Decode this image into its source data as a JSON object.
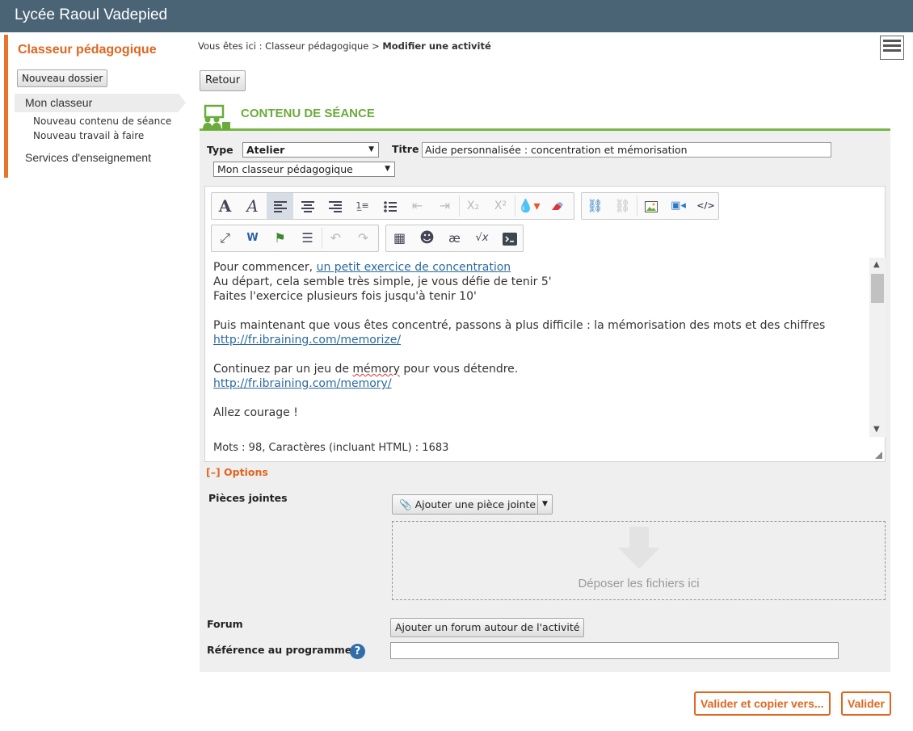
{
  "app": {
    "title": "Lycée Raoul Vadepied"
  },
  "sidebar": {
    "title": "Classeur pédagogique",
    "new_folder": "Nouveau dossier",
    "mon_classeur": "Mon classeur",
    "sub_items": [
      "Nouveau contenu de séance",
      "Nouveau travail à faire"
    ],
    "services": "Services d'enseignement"
  },
  "breadcrumb": {
    "prefix": "Vous êtes ici :",
    "parent": "Classeur pédagogique",
    "separator": ">",
    "current": "Modifier une activité"
  },
  "back_button": "Retour",
  "section": {
    "title": "CONTENU DE SÉANCE"
  },
  "form": {
    "type_label": "Type",
    "type_value": "Atelier",
    "title_label": "Titre",
    "title_value": "Aide personnalisée : concentration et mémorisation",
    "classeur_value": "Mon classeur pédagogique"
  },
  "editor": {
    "toolbar_row1": [
      "bold-font-icon",
      "italic-font-icon",
      "align-left-icon",
      "align-center-icon",
      "align-right-icon",
      "ordered-list-icon",
      "unordered-list-icon",
      "outdent-icon",
      "indent-icon",
      "subscript-icon",
      "superscript-icon",
      "text-color-icon",
      "highlight-icon",
      "link-icon",
      "unlink-icon",
      "image-icon",
      "media-icon",
      "source-code-icon"
    ],
    "toolbar_row2": [
      "fullscreen-icon",
      "paste-word-icon",
      "flag-icon",
      "list-table-icon",
      "undo-icon",
      "redo-icon",
      "table-icon",
      "emoji-icon",
      "special-chars-icon",
      "formula-icon",
      "terminal-icon"
    ],
    "glyphs": {
      "subscript": "X₂",
      "superscript": "X²",
      "special_chars": "æ",
      "formula": "√x"
    },
    "content": {
      "line1_text": "Pour commencer, ",
      "line1_link": "un petit exercice de concentration ",
      "line2": "Au départ, cela semble très simple, je vous défie de tenir 5'",
      "line3": "Faites l'exercice plusieurs fois jusqu'à tenir 10'",
      "line4": "Puis maintenant que vous êtes concentré, passons à plus difficile : la mémorisation des mots et des chiffres",
      "link1": "http://fr.ibraining.com/memorize/",
      "line5_before": "Continuez par un jeu de ",
      "line5_word": "mémory",
      "line5_after": " pour vous détendre.",
      "link2": "http://fr.ibraining.com/memory/",
      "line6": "Allez courage !"
    },
    "status": "Mots : 98, Caractères (incluant HTML) : 1683"
  },
  "options": {
    "toggle": "[–]",
    "label": "Options"
  },
  "attachments": {
    "label": "Pièces jointes",
    "add_button": "Ajouter une pièce jointe",
    "dropzone_text": "Déposer les fichiers ici"
  },
  "forum": {
    "label": "Forum",
    "button": "Ajouter un forum autour de l'activité"
  },
  "reference": {
    "label": "Référence au programme",
    "help": "?"
  },
  "actions": {
    "validate_copy": "Valider et copier vers...",
    "validate": "Valider"
  },
  "colors": {
    "header_bg": "#4a6476",
    "accent_orange": "#e0661f",
    "accent_green": "#7ab648",
    "link_blue": "#2b6a9e"
  }
}
